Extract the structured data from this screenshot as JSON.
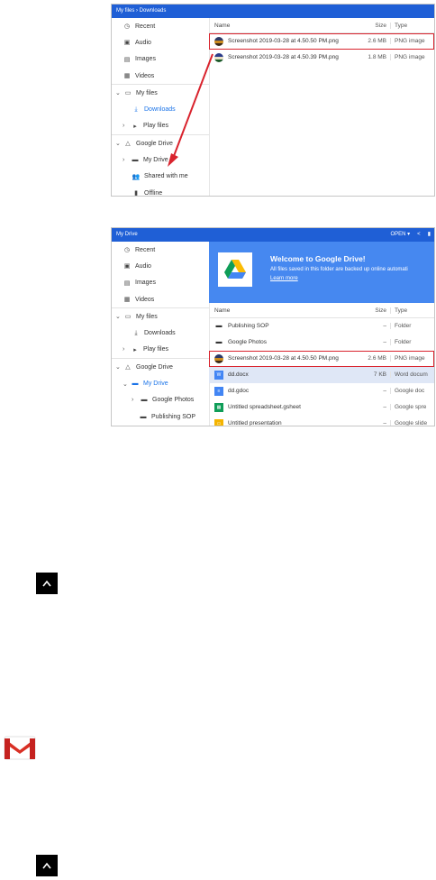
{
  "shot1": {
    "breadcrumb": "My files  ›  Downloads",
    "sidebar": [
      {
        "label": "Recent",
        "icon": "clock-icon"
      },
      {
        "label": "Audio",
        "icon": "audio-icon"
      },
      {
        "label": "Images",
        "icon": "image-icon"
      },
      {
        "label": "Videos",
        "icon": "video-icon"
      },
      {
        "label": "My files",
        "icon": "laptop-icon"
      },
      {
        "label": "Downloads",
        "icon": "download-icon"
      },
      {
        "label": "Play files",
        "icon": "play-icon"
      },
      {
        "label": "Google Drive",
        "icon": "drive-icon"
      },
      {
        "label": "My Drive",
        "icon": "folder-icon"
      },
      {
        "label": "Shared with me",
        "icon": "people-icon"
      },
      {
        "label": "Offline",
        "icon": "pin-icon"
      }
    ],
    "columns": {
      "name": "Name",
      "size": "Size",
      "type": "Type"
    },
    "files": [
      {
        "name": "Screenshot 2019-03-28 at 4.50.50 PM.png",
        "size": "2.6 MB",
        "type": "PNG image"
      },
      {
        "name": "Screenshot 2019-03-28 at 4.50.39 PM.png",
        "size": "1.8 MB",
        "type": "PNG image"
      }
    ]
  },
  "shot2": {
    "title": "My Drive",
    "open_label": "OPEN ▾",
    "sidebar": [
      {
        "label": "Recent",
        "icon": "clock-icon"
      },
      {
        "label": "Audio",
        "icon": "audio-icon"
      },
      {
        "label": "Images",
        "icon": "image-icon"
      },
      {
        "label": "Videos",
        "icon": "video-icon"
      },
      {
        "label": "My files",
        "icon": "laptop-icon"
      },
      {
        "label": "Downloads",
        "icon": "download-icon"
      },
      {
        "label": "Play files",
        "icon": "play-icon"
      },
      {
        "label": "Google Drive",
        "icon": "drive-icon"
      },
      {
        "label": "My Drive",
        "icon": "folder-icon"
      },
      {
        "label": "Google Photos",
        "icon": "folder-icon"
      },
      {
        "label": "Publishing SOP",
        "icon": "folder-icon"
      }
    ],
    "banner": {
      "title": "Welcome to Google Drive!",
      "subtitle": "All files saved in this folder are backed up online automati",
      "link": "Learn more"
    },
    "columns": {
      "name": "Name",
      "size": "Size",
      "type": "Type"
    },
    "files": [
      {
        "name": "Publishing SOP",
        "size": "–",
        "type": "Folder"
      },
      {
        "name": "Google Photos",
        "size": "–",
        "type": "Folder"
      },
      {
        "name": "Screenshot 2019-03-28 at 4.50.50 PM.png",
        "size": "2.6 MB",
        "type": "PNG image"
      },
      {
        "name": "dd.docx",
        "size": "7 KB",
        "type": "Word docum"
      },
      {
        "name": "dd.gdoc",
        "size": "–",
        "type": "Google doc"
      },
      {
        "name": "Untitled spreadsheet.gsheet",
        "size": "–",
        "type": "Google spre"
      },
      {
        "name": "Untitled presentation",
        "size": "–",
        "type": "Google slide"
      }
    ]
  },
  "colors": {
    "accent": "#1f5fd6",
    "banner": "#4688f0",
    "highlight": "#d9232d"
  }
}
